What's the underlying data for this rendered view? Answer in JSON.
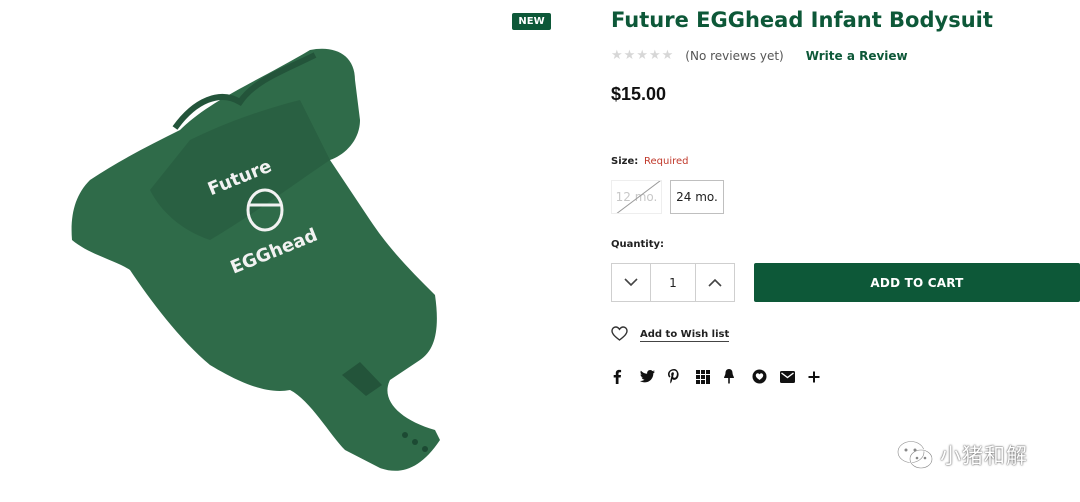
{
  "product": {
    "badge": "NEW",
    "title": "Future EGGhead Infant Bodysuit",
    "rating": {
      "stars_filled": 0,
      "stars_total": 5,
      "reviews_text": "(No reviews yet)",
      "write_review_label": "Write a Review"
    },
    "price": "$15.00",
    "image": {
      "print_line1": "Future",
      "print_line2": "EGGhead",
      "colors": {
        "fabric": "#2f6b49",
        "fabric_dark": "#23543a",
        "print": "#f2f2f2"
      }
    }
  },
  "size": {
    "label": "Size:",
    "required_text": "Required",
    "options": [
      {
        "label": "12 mo.",
        "state": "unavailable"
      },
      {
        "label": "24 mo.",
        "state": "available"
      }
    ]
  },
  "quantity": {
    "label": "Quantity:",
    "value": "1"
  },
  "add_to_cart_label": "ADD TO CART",
  "wishlist_label": "Add to Wish list",
  "share_icons": [
    "facebook-icon",
    "twitter-icon",
    "pinterest-icon",
    "grid-icon",
    "pin-icon",
    "chat-icon",
    "email-icon",
    "plus-icon"
  ],
  "watermark": {
    "text": "小猪和解"
  },
  "colors": {
    "brand": "#0d5838",
    "required": "#c0392b",
    "star_empty": "#d7d7d7"
  }
}
